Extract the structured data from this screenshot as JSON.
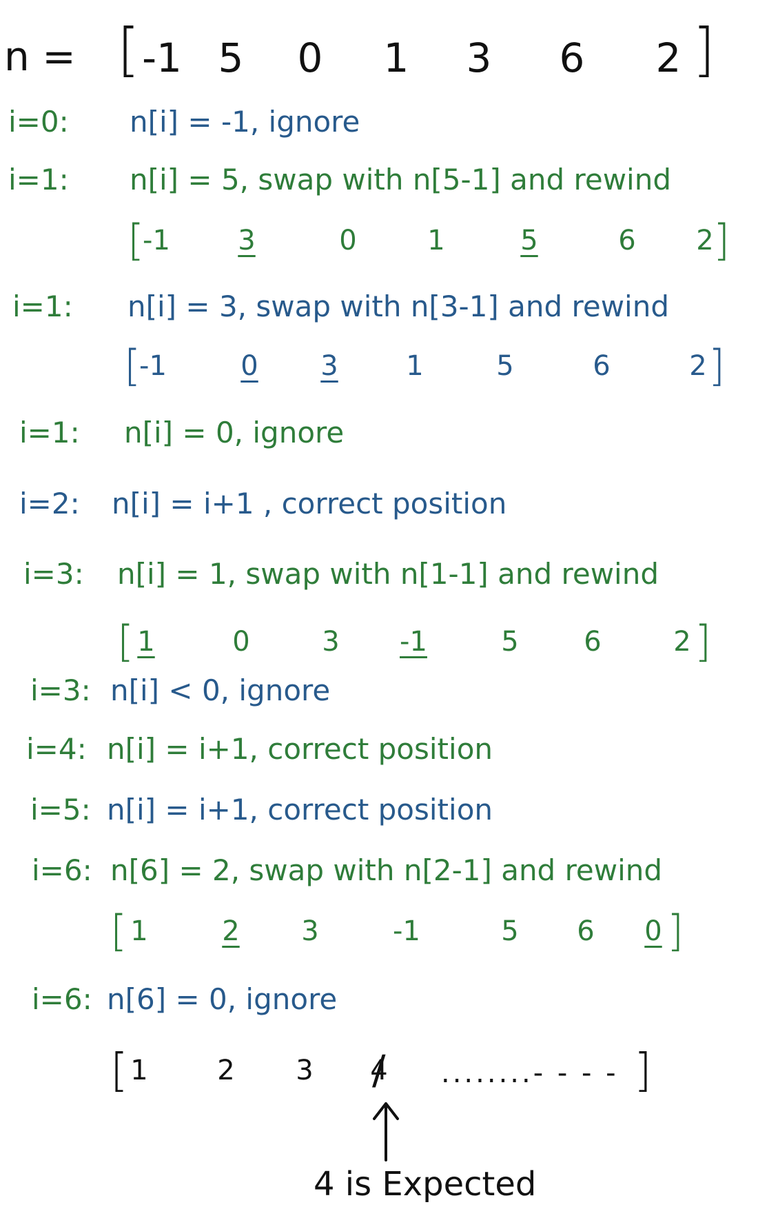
{
  "header": {
    "label": "n =",
    "values": [
      "-1",
      "5",
      "0",
      "1",
      "3",
      "6",
      "2"
    ]
  },
  "steps": [
    {
      "label": "i=0:",
      "text": "n[i] = -1, ignore"
    },
    {
      "label": "i=1:",
      "text": "n[i] = 5, swap with n[5-1] and rewind"
    },
    {
      "label": "i=1:",
      "text": "n[i] = 3, swap with n[3-1] and rewind"
    },
    {
      "label": "i=1:",
      "text": "n[i] = 0, ignore"
    },
    {
      "label": "i=2:",
      "text": "n[i] = i+1 , correct position"
    },
    {
      "label": "i=3:",
      "text": "n[i] = 1, swap with n[1-1] and rewind"
    },
    {
      "label": "i=3:",
      "text": "n[i] < 0, ignore"
    },
    {
      "label": "i=4:",
      "text": "n[i] = i+1, correct position"
    },
    {
      "label": "i=5:",
      "text": "n[i] = i+1, correct position"
    },
    {
      "label": "i=6:",
      "text": "n[6] = 2, swap with n[2-1] and rewind"
    },
    {
      "label": "i=6:",
      "text": "n[6] = 0, ignore"
    }
  ],
  "arrays": [
    {
      "values": [
        "-1",
        "3",
        "0",
        "1",
        "5",
        "6",
        "2"
      ],
      "underlined": [
        1,
        4
      ]
    },
    {
      "values": [
        "-1",
        "0",
        "3",
        "1",
        "5",
        "6",
        "2"
      ],
      "underlined": [
        1,
        2
      ]
    },
    {
      "values": [
        "1",
        "0",
        "3",
        "-1",
        "5",
        "6",
        "2"
      ],
      "underlined": [
        0,
        3
      ]
    },
    {
      "values": [
        "1",
        "2",
        "3",
        "-1",
        "5",
        "6",
        "0"
      ],
      "underlined": [
        1,
        6
      ]
    }
  ],
  "final": {
    "values": [
      "1",
      "2",
      "3",
      "4"
    ],
    "dots": "........- - - -",
    "note": "4 is Expected"
  },
  "colors": {
    "black": "#111111",
    "green": "#2f7d3a",
    "blue": "#285a8c"
  }
}
